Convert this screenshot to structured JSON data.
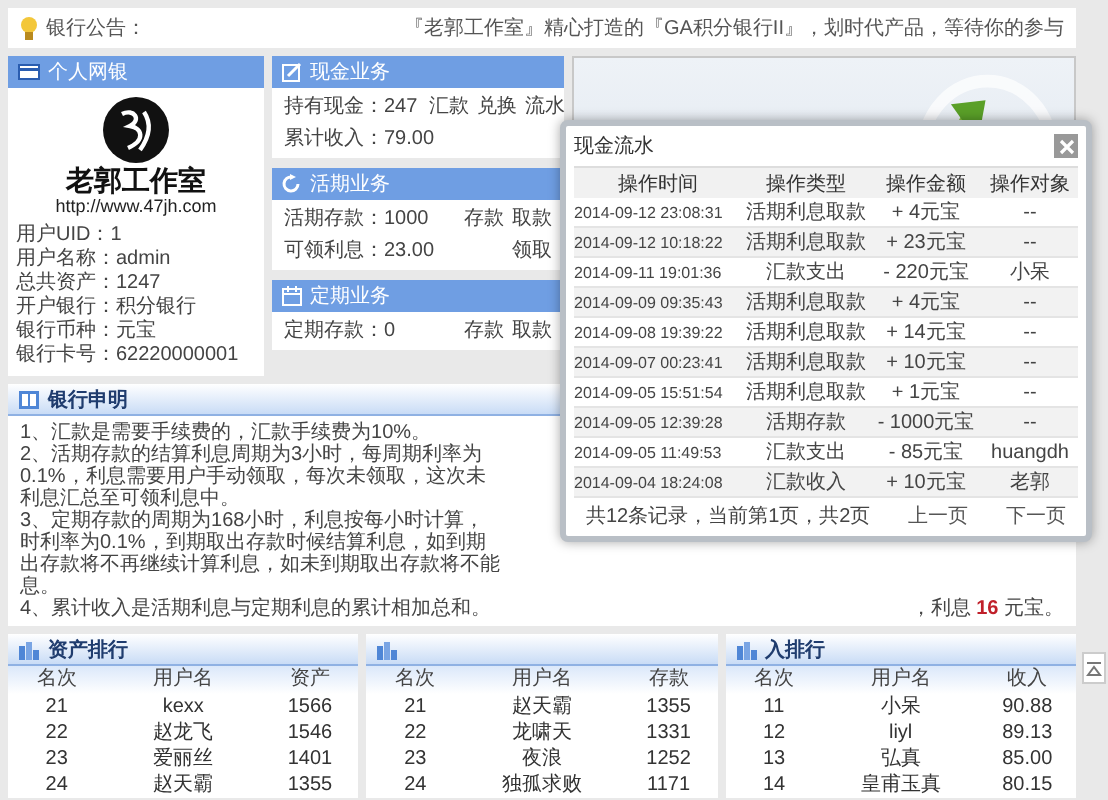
{
  "announcement": {
    "label": "银行公告：",
    "text": "『老郭工作室』精心打造的『GA积分银行II』，划时代产品，等待你的参与"
  },
  "profile": {
    "title": "个人网银",
    "logo_title": "老郭工作室",
    "logo_url": "http://www.47jh.com",
    "lines": [
      "用户UID：1",
      "用户名称：admin",
      "总共资产：1247",
      "开户银行：积分银行",
      "银行币种：元宝",
      "银行卡号：62220000001"
    ]
  },
  "services": [
    {
      "kind": "cash",
      "title": "现金业务",
      "rows": [
        {
          "text": "持有现金：247",
          "links": [
            "汇款",
            "兑换",
            "流水"
          ]
        },
        {
          "text": "累计收入：79.00"
        }
      ]
    },
    {
      "kind": "current",
      "title": "活期业务",
      "rows": [
        {
          "text": "活期存款：1000",
          "links": [
            "存款",
            "取款"
          ]
        },
        {
          "text": "可领利息：23.00",
          "links": [
            "领取"
          ]
        }
      ]
    },
    {
      "kind": "fixed",
      "title": "定期业务",
      "rows": [
        {
          "text": "定期存款：0",
          "links": [
            "存款",
            "取款"
          ]
        }
      ]
    }
  ],
  "notes": {
    "title": "银行申明",
    "lines": [
      "1、汇款是需要手续费的，汇款手续费为10%。",
      "2、活期存款的结算利息周期为3小时，每周期利率为",
      "0.1%，利息需要用户手动领取，每次未领取，这次未",
      "利息汇总至可领利息中。",
      "3、定期存款的周期为168小时，利息按每小时计算，",
      "时利率为0.1%，到期取出存款时候结算利息，如到期",
      "出存款将不再继续计算利息，如未到期取出存款将不能",
      "息。",
      "4、累计收入是活期利息与定期利息的累计相加总和。"
    ],
    "aside": "，利息 **16** 元宝。"
  },
  "rankings": [
    {
      "title": "资产排行",
      "columns": [
        "名次",
        "用户名",
        "资产"
      ],
      "rows": [
        [
          "21",
          "kexx",
          "1566"
        ],
        [
          "22",
          "赵龙飞",
          "1546"
        ],
        [
          "23",
          "爱丽丝",
          "1401"
        ],
        [
          "24",
          "赵天霸",
          "1355"
        ]
      ]
    },
    {
      "columns": [
        "名次",
        "用户名",
        "存款"
      ],
      "rows": [
        [
          "21",
          "赵天霸",
          "1355"
        ],
        [
          "22",
          "龙啸天",
          "1331"
        ],
        [
          "23",
          "夜浪",
          "1252"
        ],
        [
          "24",
          "独孤求败",
          "1171"
        ]
      ]
    },
    {
      "title": "入排行",
      "columns": [
        "名次",
        "用户名",
        "收入"
      ],
      "rows": [
        [
          "11",
          "小呆",
          "90.88"
        ],
        [
          "12",
          "liyl",
          "89.13"
        ],
        [
          "13",
          "弘真",
          "85.00"
        ],
        [
          "14",
          "皇甫玉真",
          "80.15"
        ]
      ]
    }
  ],
  "modal": {
    "title": "现金流水",
    "columns": [
      "操作时间",
      "操作类型",
      "操作金额",
      "操作对象"
    ],
    "rows": [
      [
        "2014-09-12 23:08:31",
        "活期利息取款",
        "+ 4元宝",
        "--"
      ],
      [
        "2014-09-12 10:18:22",
        "活期利息取款",
        "+ 23元宝",
        "--"
      ],
      [
        "2014-09-11 19:01:36",
        "汇款支出",
        "- 220元宝",
        "小呆"
      ],
      [
        "2014-09-09 09:35:43",
        "活期利息取款",
        "+ 4元宝",
        "--"
      ],
      [
        "2014-09-08 19:39:22",
        "活期利息取款",
        "+ 14元宝",
        "--"
      ],
      [
        "2014-09-07 00:23:41",
        "活期利息取款",
        "+ 10元宝",
        "--"
      ],
      [
        "2014-09-05 15:51:54",
        "活期利息取款",
        "+ 1元宝",
        "--"
      ],
      [
        "2014-09-05 12:39:28",
        "活期存款",
        "- 1000元宝",
        "--"
      ],
      [
        "2014-09-05 11:49:53",
        "汇款支出",
        "- 85元宝",
        "huangdh"
      ],
      [
        "2014-09-04 18:24:08",
        "汇款收入",
        "+ 10元宝",
        "老郭"
      ]
    ],
    "summary": "共12条记录，当前第1页，共2页",
    "prev": "上一页",
    "next": "下一页"
  }
}
